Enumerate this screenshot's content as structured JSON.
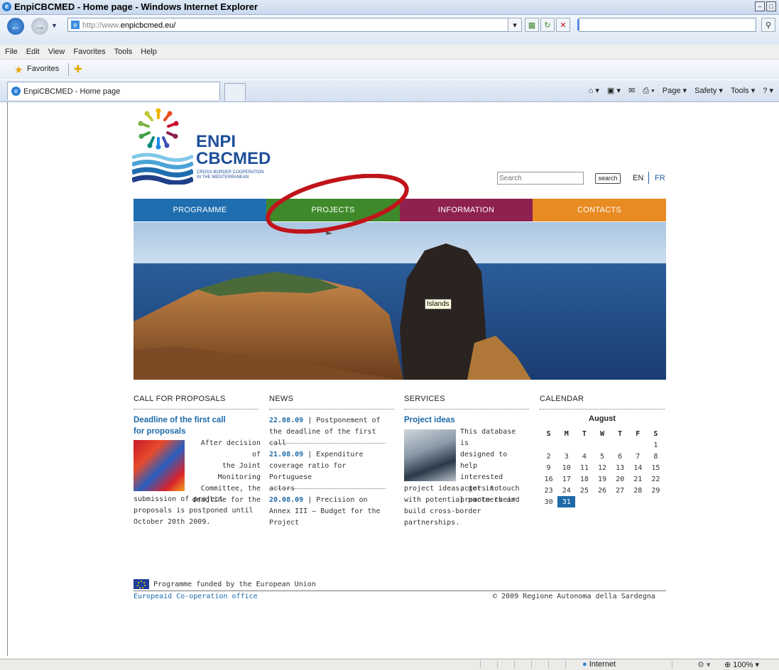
{
  "browser": {
    "title": "EnpiCBCMED - Home page - Windows Internet Explorer",
    "url_prefix": "http://www.",
    "url_domain": "enpicbcmed.eu/",
    "menu": [
      "File",
      "Edit",
      "View",
      "Favorites",
      "Tools",
      "Help"
    ],
    "favorites_label": "Favorites",
    "tab_title": "EnpiCBCMED - Home page",
    "commands": [
      "Page ▾",
      "Safety ▾",
      "Tools ▾"
    ],
    "status_zone": "Internet",
    "zoom": "100%"
  },
  "site": {
    "logo_line1": "ENPI",
    "logo_line2": "CBCMED",
    "logo_line3": "CROSS-BORDER COOPERATION",
    "logo_line4": "IN THE MEDITERRANEAN",
    "search_placeholder": "Search",
    "search_button": "search",
    "lang_en": "EN",
    "lang_fr": "FR",
    "nav": [
      {
        "label": "PROGRAMME",
        "color": "#1f6eb0"
      },
      {
        "label": "PROJECTS",
        "color": "#3e8a2a"
      },
      {
        "label": "INFORMATION",
        "color": "#8e2150"
      },
      {
        "label": "CONTACTS",
        "color": "#e98b23"
      }
    ],
    "highlight_color": "#c0141a",
    "hero_tooltip": "Islands"
  },
  "call_for_proposals": {
    "heading": "CALL FOR PROPOSALS",
    "title_line1": "Deadline of the first call",
    "title_line2": "for proposals",
    "text_lines": [
      "After decision of",
      "the Joint",
      "Monitoring",
      "Committee, the",
      "deadline for the"
    ],
    "text_lines_full": [
      "submission of project",
      "proposals is postponed until",
      "October 20th 2009."
    ]
  },
  "news": {
    "heading": "NEWS",
    "items": [
      {
        "date": "22.08.09",
        "text1": " | Postponement of",
        "text2": "the deadline of the first call",
        "text3": ""
      },
      {
        "date": "21.08.09",
        "text1": " | Expenditure",
        "text2": "coverage ratio for Portuguese",
        "text3": "actors"
      },
      {
        "date": "20.08.09",
        "text1": " | Precision on",
        "text2": "Annex III – Budget for the",
        "text3": "Project"
      }
    ]
  },
  "services": {
    "heading": "SERVICES",
    "title": "Project ideas",
    "text_lines": [
      "This database is",
      "designed to help",
      "interested",
      "actors to",
      "promote their"
    ],
    "text_lines_full": [
      "project ideas, get in touch",
      "with potential partners and",
      "build cross-border",
      "partnerships."
    ]
  },
  "calendar": {
    "heading": "CALENDAR",
    "month": "August",
    "weekdays": [
      "S",
      "M",
      "T",
      "W",
      "T",
      "F",
      "S"
    ],
    "weeks": [
      [
        "",
        "",
        "",
        "",
        "",
        "",
        "1"
      ],
      [
        "2",
        "3",
        "4",
        "5",
        "6",
        "7",
        "8"
      ],
      [
        "9",
        "10",
        "11",
        "12",
        "13",
        "14",
        "15"
      ],
      [
        "16",
        "17",
        "18",
        "19",
        "20",
        "21",
        "22"
      ],
      [
        "23",
        "24",
        "25",
        "26",
        "27",
        "28",
        "29"
      ],
      [
        "30",
        "31",
        "",
        "",
        "",
        "",
        ""
      ]
    ],
    "today": "31"
  },
  "footer": {
    "funded": "Programme funded by the European Union",
    "left_link": "Europeaid Co-operation office",
    "copyright": "© 2009 Regione Autonoma della Sardegna"
  }
}
